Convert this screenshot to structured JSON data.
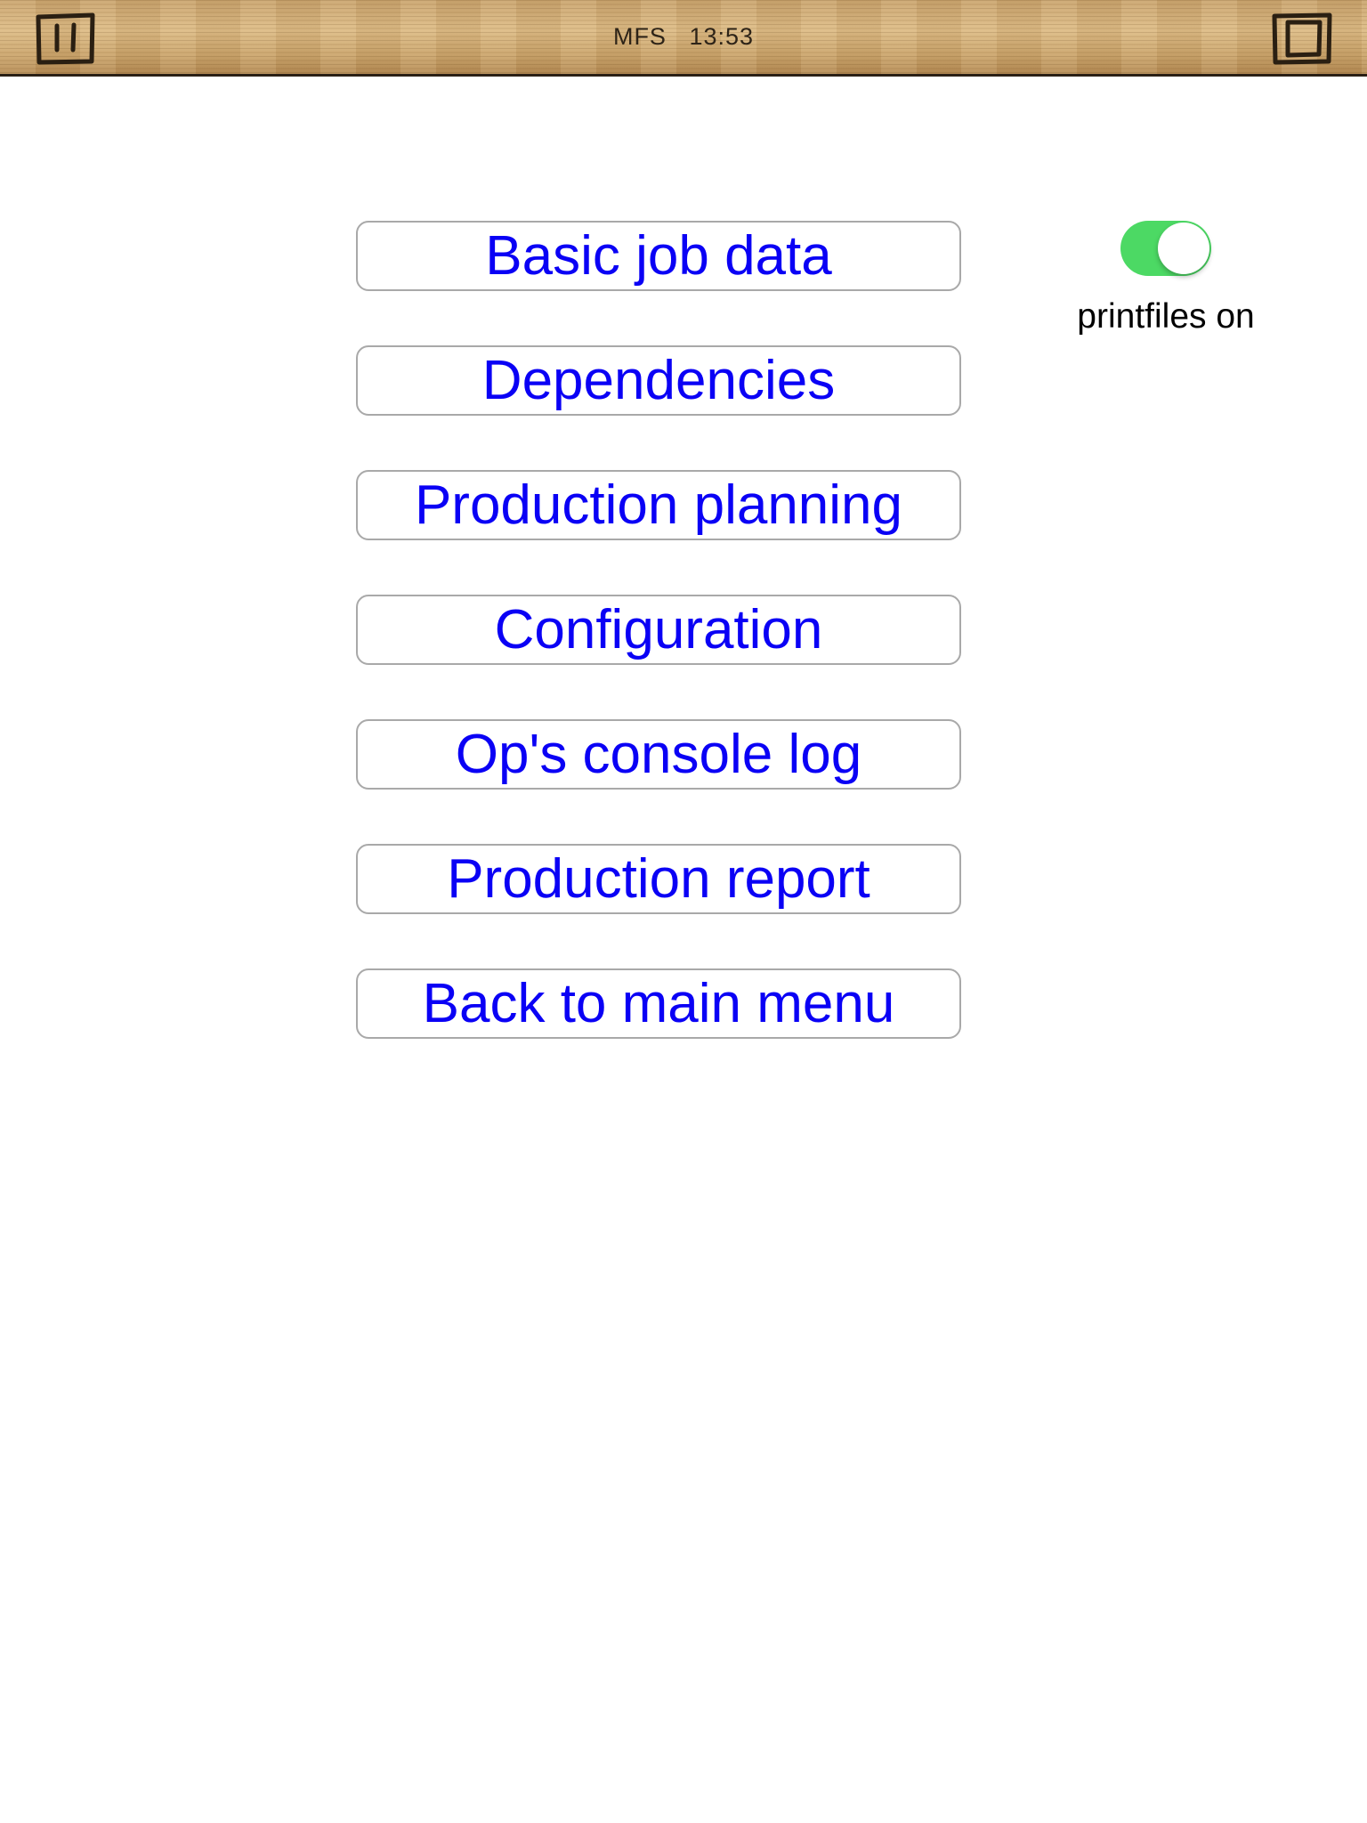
{
  "header": {
    "title": "MFS   13:53",
    "left_icon": "pause-icon",
    "right_icon": "window-icon"
  },
  "menu": {
    "buttons": [
      {
        "label": "Basic job data"
      },
      {
        "label": "Dependencies"
      },
      {
        "label": "Production planning"
      },
      {
        "label": "Configuration"
      },
      {
        "label": "Op's console log"
      },
      {
        "label": "Production report"
      },
      {
        "label": "Back to main menu"
      }
    ]
  },
  "printfiles": {
    "label": "printfiles on",
    "enabled": true
  },
  "colors": {
    "button_text": "#0a00f5",
    "button_border": "#a9a9a9",
    "toggle_on": "#4cd964",
    "wood": "#d2ae79"
  }
}
